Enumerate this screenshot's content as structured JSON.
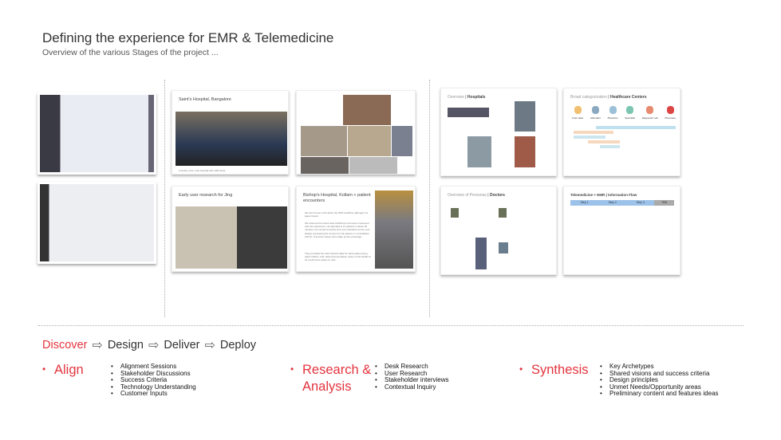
{
  "header": {
    "title": "Defining the experience for EMR & Telemedicine",
    "subtitle": "Overview of the various Stages of the project ..."
  },
  "slides": {
    "saints": {
      "title": "Saint's Hospital, Bangalore",
      "caption": "A tertiary care, trust hospital with 1200 beds."
    },
    "jing": {
      "title": "Early user research for Jing"
    },
    "bishops": {
      "title": "Bishop's Hospital, Kollam + patient encounters",
      "p1": "We don't know much about the OPD workflow, although it is paper based.",
      "p2": "We observed his ward visits at Bishop's and were impressed with the experience. He attended to 11 patients in about 25 minutes, but moved smoothly from one interaction to the next, always expressing his concern for the patient, in consultation with Dr. S and the sisters who made up his entourage.",
      "p3": "They provided him with relevant data for each patient using paper folders, and made documentation notes on his behalf so he could focus solely on care."
    },
    "hospitals": {
      "title_a": "Overview",
      "title_b": "Hospitals"
    },
    "centers": {
      "title_a": "Broad categorization",
      "title_b": "Healthcare Centers",
      "roles": [
        "Front desk",
        "Attendant",
        "Physician",
        "Specialist",
        "Diagnostic Lab",
        "Pharmacy"
      ]
    },
    "personas": {
      "title_a": "Overview of Personas",
      "title_b": "Doctors"
    },
    "flow": {
      "title": "Telemedicine + EMR | Information Flow",
      "steps": [
        "Step 1",
        "Step 2",
        "Step 3",
        "TBD"
      ]
    }
  },
  "stages": [
    "Discover",
    "Design",
    "Deliver",
    "Deploy"
  ],
  "phases": [
    {
      "name": "Align",
      "items": [
        "Alignment Sessions",
        "Stakeholder Discussions",
        "Success Criteria",
        "Technology Understanding",
        "Customer Inputs"
      ]
    },
    {
      "name_line1": "Research &",
      "name_line2": "Analysis",
      "items": [
        "Desk Research",
        "User Research",
        "Stakeholder interviews",
        "Contextual Inquiry"
      ]
    },
    {
      "name": "Synthesis",
      "items": [
        "Key Archetypes",
        "Shared visions and success criteria",
        "Design principles",
        "Unmet Needs/Opportunity areas",
        "Preliminary content and features ideas"
      ]
    }
  ],
  "colors": {
    "accent": "#e3343e"
  }
}
